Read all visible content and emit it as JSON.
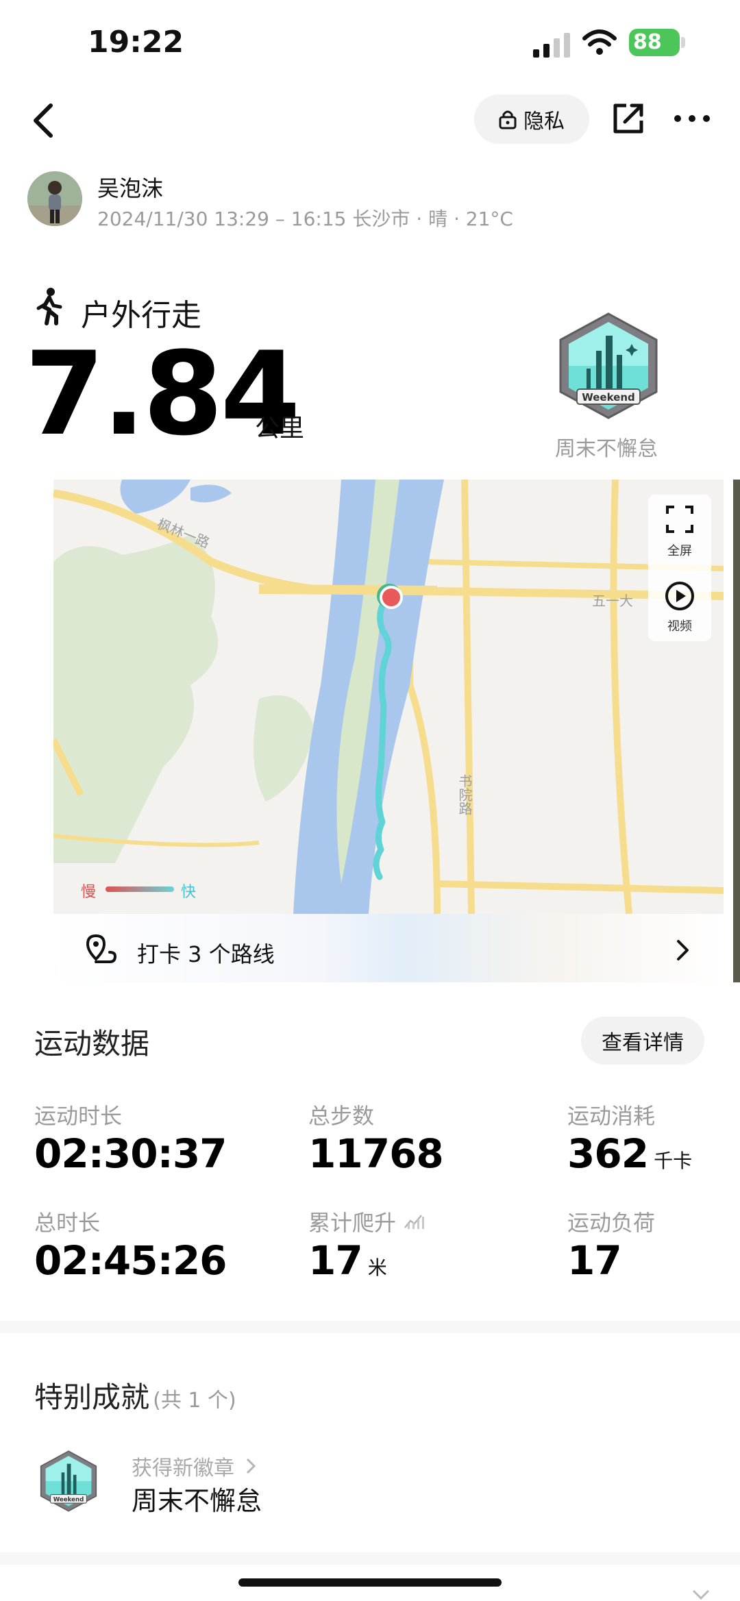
{
  "status_bar": {
    "time": "19:22",
    "battery": "88"
  },
  "nav": {
    "privacy_label": "隐私"
  },
  "user": {
    "name": "吴泡沫",
    "meta": "2024/11/30 13:29 – 16:15 长沙市 · 晴 · 21°C"
  },
  "activity": {
    "type": "户外行走",
    "distance": "7.84",
    "unit": "公里",
    "badge_caption": "周末不懈怠"
  },
  "map": {
    "fullscreen_label": "全屏",
    "video_label": "视频",
    "road_labels": [
      "枫林一路",
      "五一大",
      "书院路"
    ],
    "legend_slow": "慢",
    "legend_fast": "快",
    "checkin_text": "打卡 3 个路线"
  },
  "stats": {
    "title": "运动数据",
    "detail_button": "查看详情",
    "items": [
      {
        "label": "运动时长",
        "value": "02:30:37",
        "unit": ""
      },
      {
        "label": "总步数",
        "value": "11768",
        "unit": ""
      },
      {
        "label": "运动消耗",
        "value": "362",
        "unit": "千卡"
      },
      {
        "label": "总时长",
        "value": "02:45:26",
        "unit": ""
      },
      {
        "label": "累计爬升",
        "value": "17",
        "unit": "米"
      },
      {
        "label": "运动负荷",
        "value": "17",
        "unit": ""
      }
    ]
  },
  "achievements": {
    "title": "特别成就",
    "count": "(共 1 个)",
    "new_badge_label": "获得新徽章",
    "badge_name": "周末不懈怠",
    "badge_text": "Weekend"
  },
  "colors": {
    "accent_teal": "#5fd3d6",
    "route_start": "#e85a5a",
    "battery_green": "#4cc659",
    "water": "#a9c6ec",
    "road": "#f6dd8e"
  }
}
